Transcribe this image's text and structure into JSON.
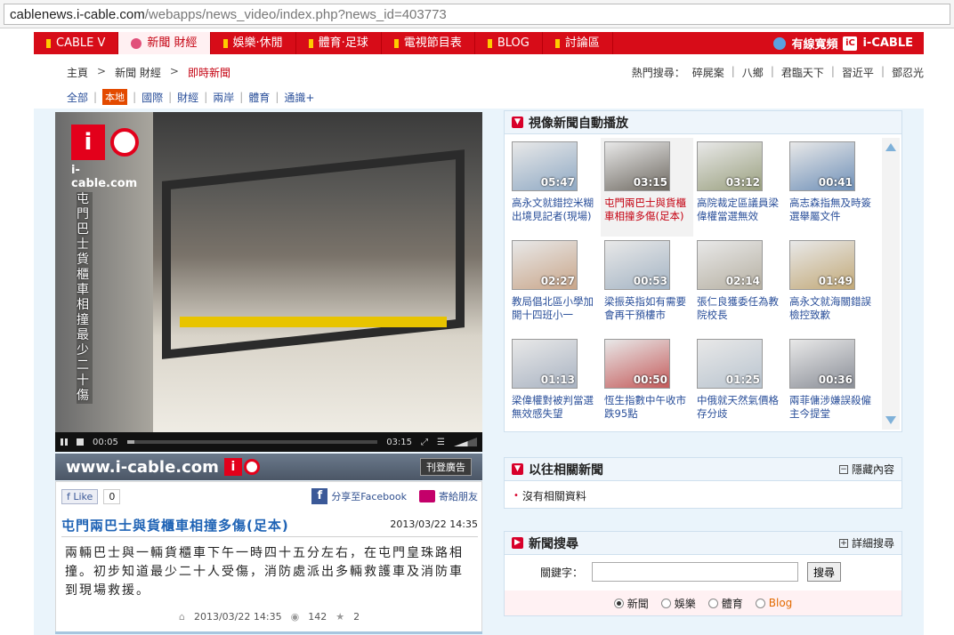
{
  "browser": {
    "url_host": "cablenews.i-cable.com",
    "url_path": "/webapps/news_video/index.php?news_id=403773"
  },
  "topnav": {
    "items": [
      {
        "label": "CABLE V"
      },
      {
        "label": "新聞 財經"
      },
      {
        "label": "娛樂·休閒"
      },
      {
        "label": "體育·足球"
      },
      {
        "label": "電視節目表"
      },
      {
        "label": "BLOG"
      },
      {
        "label": "討論區"
      }
    ],
    "brand": "有線寬頻",
    "brand_logo_text": "i-CABLE",
    "brand_badge": "iC"
  },
  "breadcrumb": {
    "home": "主頁",
    "section": "新聞 財經",
    "current": "即時新聞",
    "sep": ">"
  },
  "hot_search": {
    "label": "熱門搜尋：",
    "items": [
      "碎屍案",
      "八鄉",
      "君臨天下",
      "習近平",
      "鄧忍光"
    ]
  },
  "subtabs": {
    "items": [
      "全部",
      "本地",
      "國際",
      "財經",
      "兩岸",
      "體育",
      "通識+"
    ],
    "active": "本地"
  },
  "player": {
    "logo_badge": "i",
    "logo_text": "i-cable.com",
    "vertical_caption": "屯門巴士貨櫃車相撞最少二十傷",
    "time_current": "00:05",
    "time_total": "03:15",
    "progress_fraction": 0.03
  },
  "adstrip": {
    "site": "www.i-cable.com",
    "mini_badge": "i",
    "ad_button": "刊登廣告"
  },
  "article": {
    "like_label": "Like",
    "like_count": "0",
    "share_fb": "分享至Facebook",
    "fb_letter": "f",
    "mail_friend": "寄給朋友",
    "title": "屯門兩巴士與貨櫃車相撞多傷(足本)",
    "datetime": "2013/03/22 14:35",
    "body": "兩輛巴士與一輛貨櫃車下午一時四十五分左右，在屯門皇珠路相撞。初步知道最少二十人受傷，消防處派出多輛救護車及消防車到現場救援。",
    "meta_datetime": "2013/03/22 14:35",
    "meta_views": "142",
    "meta_stars": "2"
  },
  "video_panel": {
    "title": "視像新聞自動播放",
    "videos": [
      {
        "duration": "05:47",
        "caption": "高永文就錯控米糊出境見記者(現場)"
      },
      {
        "duration": "03:15",
        "caption": "屯門兩巴士與貨櫃車相撞多傷(足本)",
        "selected": true
      },
      {
        "duration": "03:12",
        "caption": "高院裁定區議員梁偉權當選無效"
      },
      {
        "duration": "00:41",
        "caption": "高志森指無及時簽選舉屬文件"
      },
      {
        "duration": "02:27",
        "caption": "教局倡北區小學加開十四班小一"
      },
      {
        "duration": "00:53",
        "caption": "梁振英指如有需要會再干預樓市"
      },
      {
        "duration": "02:14",
        "caption": "張仁良獲委任為教院校長"
      },
      {
        "duration": "01:49",
        "caption": "高永文就海關錯誤檢控致歉"
      },
      {
        "duration": "01:13",
        "caption": "梁偉權對被判當選無效感失望"
      },
      {
        "duration": "00:50",
        "caption": "恆生指數中午收市跌95點"
      },
      {
        "duration": "01:25",
        "caption": "中俄就天然氣價格存分歧"
      },
      {
        "duration": "00:36",
        "caption": "兩菲傭涉嫌誤殺僱主今提堂"
      }
    ]
  },
  "related_panel": {
    "title": "以往相關新聞",
    "toggle": "隱藏內容",
    "toggle_sign": "−",
    "empty": "沒有相關資料"
  },
  "search_panel": {
    "title": "新聞搜尋",
    "advanced": "詳細搜尋",
    "advanced_sign": "+",
    "keyword_label": "關鍵字：",
    "keyword_value": "",
    "submit": "搜尋",
    "options": [
      {
        "label": "新聞",
        "checked": true
      },
      {
        "label": "娛樂",
        "checked": false
      },
      {
        "label": "體育",
        "checked": false
      },
      {
        "label": "Blog",
        "checked": false
      }
    ]
  }
}
